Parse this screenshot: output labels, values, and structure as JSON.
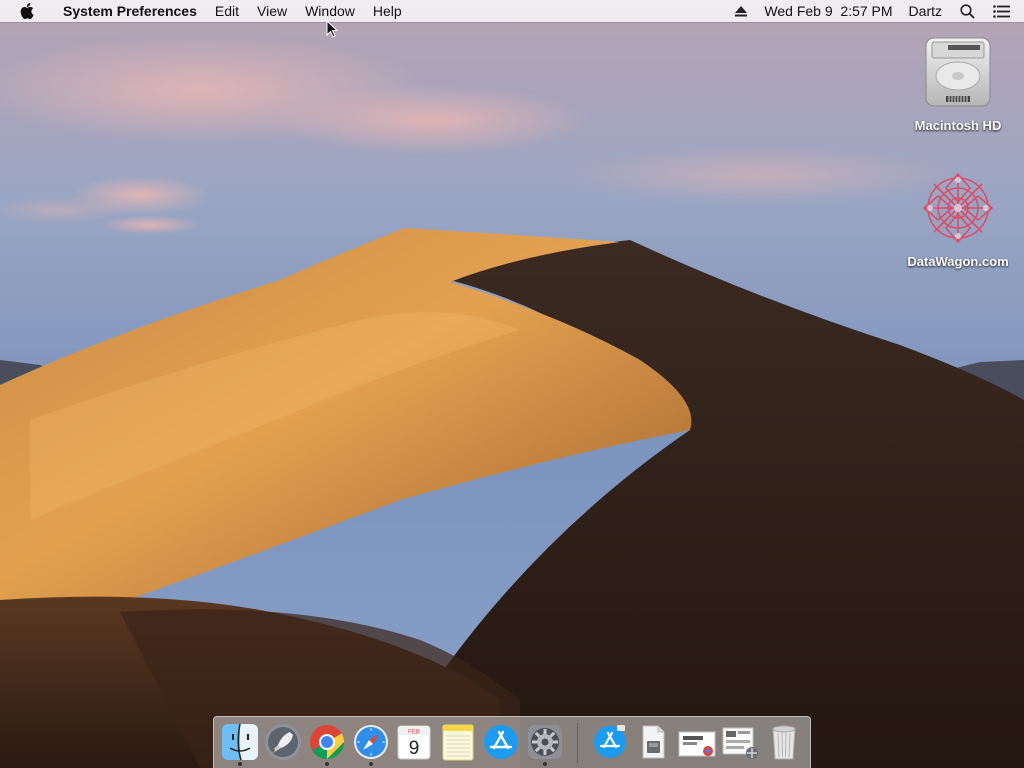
{
  "menubar": {
    "app_name": "System Preferences",
    "menus": [
      "Edit",
      "View",
      "Window",
      "Help"
    ],
    "clock": "Wed Feb 9  2:57 PM",
    "user": "Dartz"
  },
  "desktop": {
    "icons": [
      {
        "label": "Macintosh HD",
        "icon": "hard-drive-icon"
      },
      {
        "label": "DataWagon.com",
        "icon": "network-volume-icon"
      }
    ]
  },
  "dock": {
    "apps": [
      {
        "name": "Finder",
        "icon": "finder-icon",
        "running": true
      },
      {
        "name": "Launchpad",
        "icon": "launchpad-icon",
        "running": false
      },
      {
        "name": "Google Chrome",
        "icon": "chrome-icon",
        "running": true
      },
      {
        "name": "Safari",
        "icon": "safari-icon",
        "running": true
      },
      {
        "name": "Calendar",
        "icon": "calendar-icon",
        "running": false,
        "month": "FEB",
        "day": "9"
      },
      {
        "name": "Notes",
        "icon": "notes-icon",
        "running": false
      },
      {
        "name": "App Store",
        "icon": "app-store-icon",
        "running": false
      },
      {
        "name": "System Preferences",
        "icon": "system-preferences-icon",
        "running": true
      }
    ],
    "others": [
      {
        "name": "Applications",
        "icon": "applications-stack-icon"
      },
      {
        "name": "Documents",
        "icon": "documents-stack-icon"
      },
      {
        "name": "Screenshot",
        "icon": "screenshot-stack-icon"
      },
      {
        "name": "Downloads",
        "icon": "downloads-stack-icon"
      },
      {
        "name": "Trash",
        "icon": "trash-icon"
      }
    ]
  },
  "colors": {
    "menubar_bg": "#f4f2f4",
    "sky_top": "#a79cb0",
    "sky_bottom": "#6f88b5",
    "dune_light": "#d6913f",
    "dune_dark": "#2e1f18"
  }
}
